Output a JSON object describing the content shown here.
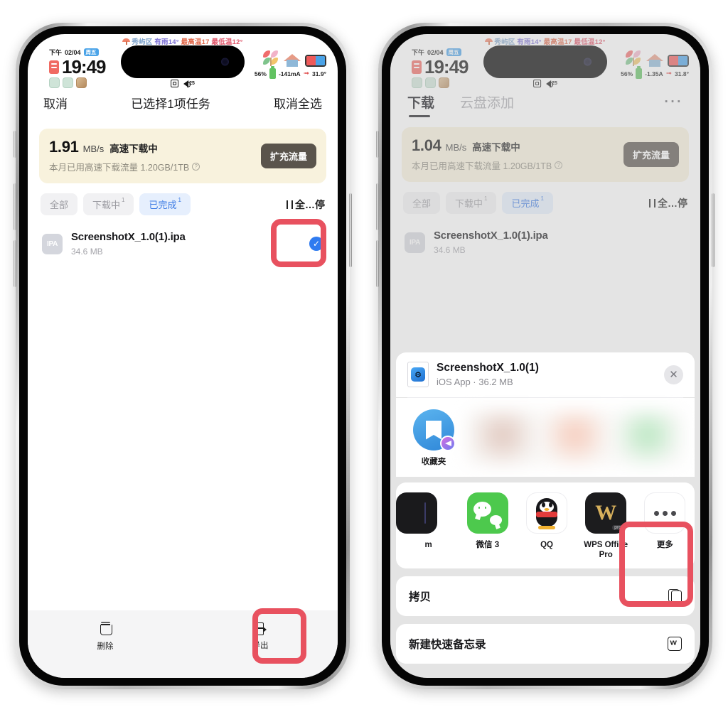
{
  "status_bar": {
    "weather": {
      "umbrella_icon": "umbrella-icon",
      "district": "秀屿区",
      "condition": "有雨14°",
      "high": "最高温17",
      "low": "最低温12°"
    },
    "clock": {
      "period": "下午",
      "date": "02/04",
      "weekday": "周五",
      "time": "19:49"
    },
    "island": {
      "sound_value": "25"
    },
    "right": {
      "battery_percent": "56%",
      "current_left": "-141mA",
      "current_right": "-1.35A",
      "temperature_left": "31.9°",
      "temperature_right": "31.8°"
    }
  },
  "left_phone": {
    "nav": {
      "cancel": "取消",
      "title": "已选择1项任务",
      "deselect_all": "取消全选"
    },
    "banner": {
      "speed": "1.91",
      "unit": "MB/s",
      "state": "高速下载中",
      "quota": "本月已用高速下载流量 1.20GB/1TB",
      "help_icon": "question-icon",
      "cta": "扩充流量"
    },
    "filters": [
      {
        "label": "全部",
        "count": "",
        "selected": false
      },
      {
        "label": "下载中",
        "count": "1",
        "selected": false
      },
      {
        "label": "已完成",
        "count": "1",
        "selected": true
      }
    ],
    "pause_all": "全…停",
    "file": {
      "badge": "IPA",
      "name": "ScreenshotX_1.0(1).ipa",
      "size": "34.6 MB",
      "checked": true
    },
    "toolbar": [
      {
        "label": "删除",
        "icon": "trash-icon"
      },
      {
        "label": "导出",
        "icon": "export-icon",
        "highlighted": true
      }
    ]
  },
  "right_phone": {
    "tabs": [
      {
        "label": "下载",
        "active": true
      },
      {
        "label": "云盘添加",
        "active": false
      }
    ],
    "more_menu": "···",
    "banner": {
      "speed": "1.04",
      "unit": "MB/s",
      "state": "高速下载中",
      "quota": "本月已用高速下载流量 1.20GB/1TB",
      "help_icon": "question-icon",
      "cta": "扩充流量"
    },
    "filters": [
      {
        "label": "全部",
        "count": "",
        "selected": false
      },
      {
        "label": "下载中",
        "count": "1",
        "selected": false
      },
      {
        "label": "已完成",
        "count": "1",
        "selected": true
      }
    ],
    "pause_all": "全…停",
    "file": {
      "badge": "IPA",
      "name": "ScreenshotX_1.0(1).ipa",
      "size": "34.6 MB"
    },
    "share_sheet": {
      "header": {
        "title": "ScreenshotX_1.0(1)",
        "subtitle": "iOS App · 36.2 MB",
        "close_icon": "close-icon"
      },
      "airdrop": {
        "label": "收藏夹",
        "icon": "bookmark-icon",
        "badge_icon": "telegram-icon"
      },
      "apps": [
        {
          "label": "m",
          "icon": "cut-off-app-icon",
          "highlighted": false
        },
        {
          "label": "微信 3",
          "icon": "wechat-icon",
          "highlighted": false
        },
        {
          "label": "QQ",
          "icon": "qq-icon",
          "highlighted": false
        },
        {
          "label": "WPS Office Pro",
          "icon": "wps-office-icon",
          "highlighted": false
        },
        {
          "label": "更多",
          "icon": "more-dots-icon",
          "highlighted": true
        }
      ],
      "actions": [
        {
          "label": "拷贝",
          "icon": "copy-icon"
        },
        {
          "label": "新建快速备忘录",
          "icon": "quick-note-icon"
        }
      ]
    }
  },
  "colors": {
    "accent_blue": "#2f7bf0",
    "highlight_red": "#e8515f",
    "banner_bg": "#f8f2dd",
    "chip_selected_bg": "#e6effd"
  }
}
